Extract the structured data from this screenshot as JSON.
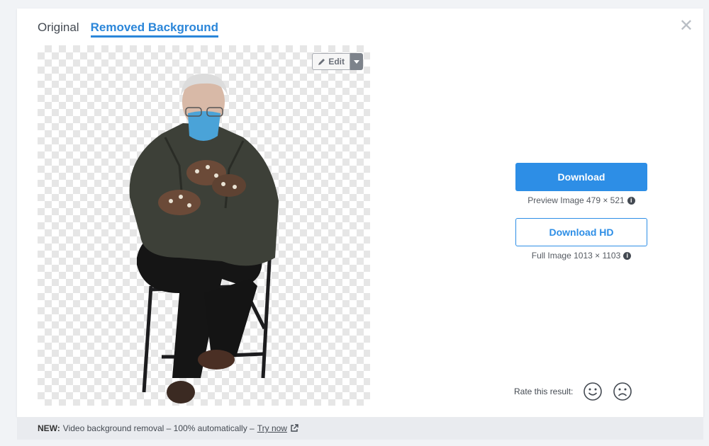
{
  "tabs": [
    {
      "label": "Original",
      "active": false
    },
    {
      "label": "Removed Background",
      "active": true
    }
  ],
  "close_icon": "close-icon",
  "preview": {
    "edit_label": "Edit",
    "edit_icon": "pencil-icon",
    "caret_icon": "caret-down-icon"
  },
  "download": {
    "label": "Download",
    "preview_info": "Preview Image 479 × 521",
    "hd_label": "Download HD",
    "full_info": "Full Image 1013 × 1103"
  },
  "rating": {
    "label": "Rate this result:",
    "happy_icon": "smile-face-icon",
    "sad_icon": "frown-face-icon"
  },
  "footer": {
    "prefix": "NEW:",
    "text": "Video background removal – 100% automatically –",
    "link": "Try now",
    "link_icon": "external-link-icon"
  },
  "colors": {
    "accent": "#2d8ee6",
    "tab_active": "#2b86d9"
  }
}
